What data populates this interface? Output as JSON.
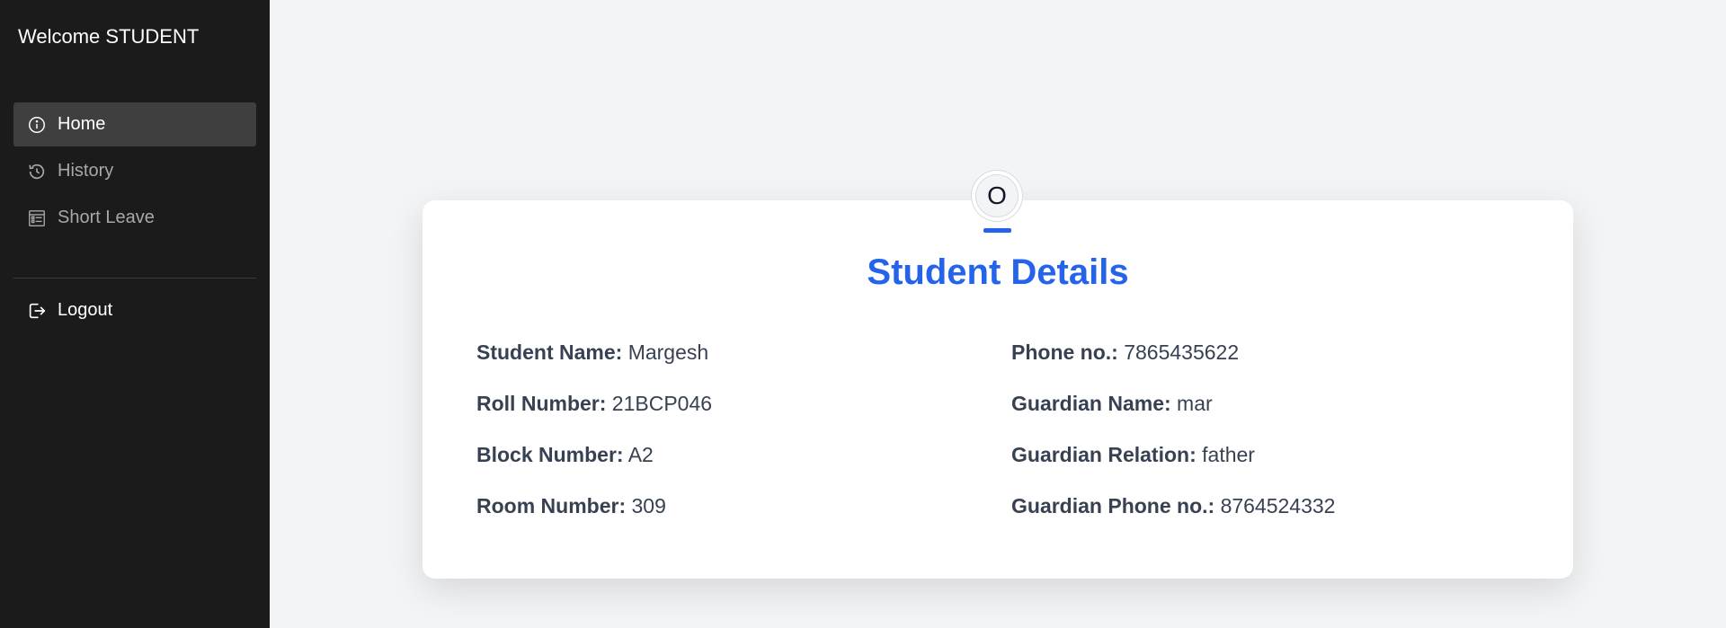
{
  "sidebar": {
    "welcome": "Welcome STUDENT",
    "items": [
      {
        "label": "Home",
        "icon": "info-circle-icon",
        "active": true
      },
      {
        "label": "History",
        "icon": "history-icon",
        "active": false
      },
      {
        "label": "Short Leave",
        "icon": "form-list-icon",
        "active": false
      }
    ],
    "logout": {
      "label": "Logout",
      "icon": "logout-icon"
    }
  },
  "card": {
    "avatar_letter": "O",
    "title": "Student Details",
    "left": [
      {
        "label": "Student Name:",
        "value": "Margesh"
      },
      {
        "label": "Roll Number:",
        "value": "21BCP046"
      },
      {
        "label": "Block Number:",
        "value": "A2"
      },
      {
        "label": "Room Number:",
        "value": "309"
      }
    ],
    "right": [
      {
        "label": "Phone no.:",
        "value": "7865435622"
      },
      {
        "label": "Guardian Name:",
        "value": "mar"
      },
      {
        "label": "Guardian Relation:",
        "value": "father"
      },
      {
        "label": "Guardian Phone no.:",
        "value": "8764524332"
      }
    ]
  },
  "colors": {
    "accent": "#2563eb",
    "sidebar_bg": "#1b1b1b",
    "page_bg": "#f3f4f6"
  }
}
